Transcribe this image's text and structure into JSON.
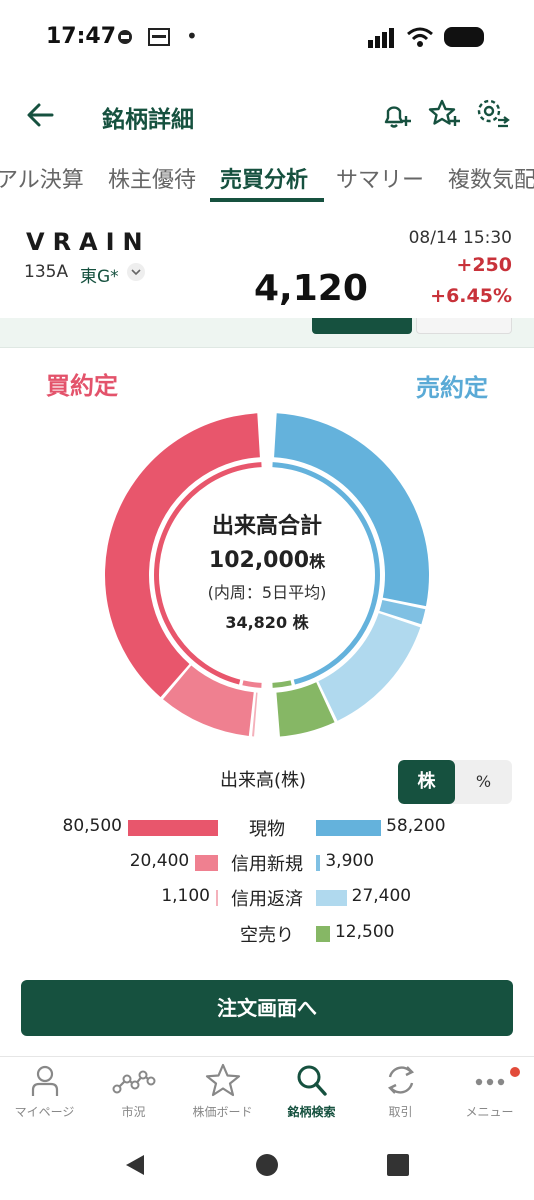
{
  "status_bar": {
    "time": "17:47",
    "dot": "•"
  },
  "header": {
    "title": "銘柄詳細"
  },
  "tabs": [
    {
      "label": "アル決算"
    },
    {
      "label": "株主優待"
    },
    {
      "label": "売買分析",
      "active": true
    },
    {
      "label": "サマリー"
    },
    {
      "label": "複数気配"
    }
  ],
  "stock": {
    "name": "VRAIN",
    "code": "135A",
    "market": "東G*",
    "price": "4,120",
    "datetime": "08/14 15:30",
    "change": "+250",
    "change_pct": "+6.45%"
  },
  "analysis": {
    "buy_label": "買約定",
    "sell_label": "売約定",
    "center": {
      "title": "出来高合計",
      "total": "102,000",
      "unit": "株",
      "sub": "(内周：5日平均)",
      "avg": "34,820"
    }
  },
  "legend": {
    "title": "出来高(株)",
    "toggle": [
      "株",
      "%"
    ],
    "rows": [
      {
        "label": "現物",
        "buy": "80,500",
        "sell": "58,200"
      },
      {
        "label": "信用新規",
        "buy": "20,400",
        "sell": "3,900"
      },
      {
        "label": "信用返済",
        "buy": "1,100",
        "sell": "27,400"
      },
      {
        "label": "空売り",
        "buy": "",
        "sell": "12,500"
      }
    ]
  },
  "chart_data": {
    "type": "pie",
    "title": "出来高合計",
    "outer": {
      "buy": [
        {
          "name": "現物",
          "value": 80500
        },
        {
          "name": "信用新規",
          "value": 20400
        },
        {
          "name": "信用返済",
          "value": 1100
        }
      ],
      "sell": [
        {
          "name": "現物",
          "value": 58200
        },
        {
          "name": "信用新規",
          "value": 3900
        },
        {
          "name": "信用返済",
          "value": 27400
        },
        {
          "name": "空売り",
          "value": 12500
        }
      ]
    },
    "total": 102000,
    "inner_avg_total": 34820
  },
  "colors": {
    "brand": "#16513f",
    "buy_spot": "#e8566c",
    "buy_margin_new": "#ef8090",
    "buy_margin_close": "#f4b1bb",
    "sell_spot": "#64b2dc",
    "sell_margin_new": "#7fc0e3",
    "sell_margin_close": "#b0d9ee",
    "short": "#86b765",
    "up": "#c8323a"
  },
  "order_button": {
    "label": "注文画面へ"
  },
  "bottom_nav": [
    {
      "label": "マイページ",
      "icon": "person-icon"
    },
    {
      "label": "市況",
      "icon": "market-icon"
    },
    {
      "label": "株価ボード",
      "icon": "star-icon"
    },
    {
      "label": "銘柄検索",
      "icon": "search-icon",
      "active": true
    },
    {
      "label": "取引",
      "icon": "refresh-icon"
    },
    {
      "label": "メニュー",
      "icon": "more-icon"
    }
  ]
}
